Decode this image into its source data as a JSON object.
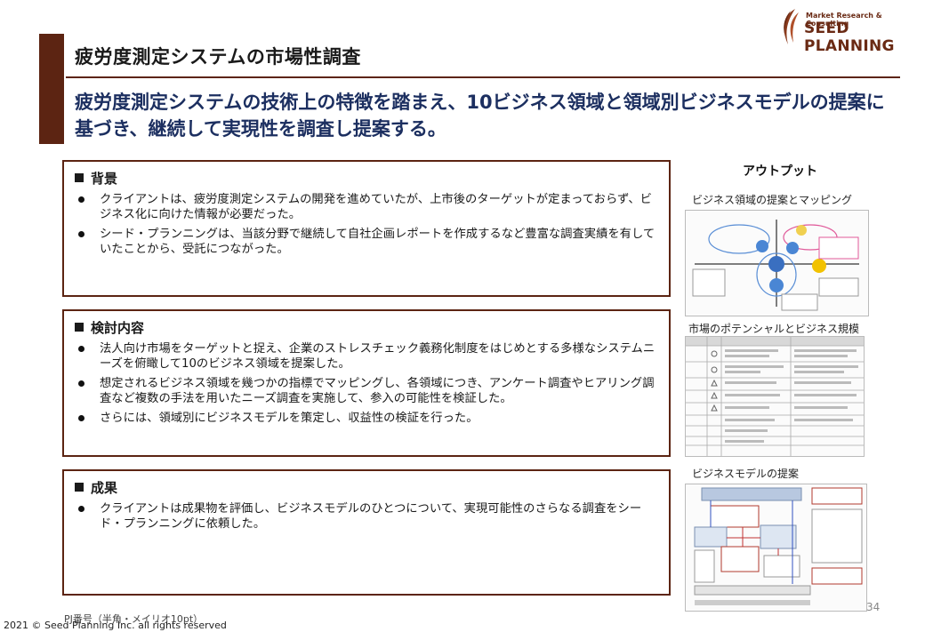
{
  "header": {
    "title": "疲労度測定システムの市場性調査",
    "lead": "疲労度測定システムの技術上の特徴を踏まえ、10ビジネス領域と領域別ビジネスモデルの提案に基づき、継続して実現性を調査し提案する。"
  },
  "logo": {
    "subtitle": "Market Research & Consulting",
    "name": "SEED PLANNING"
  },
  "sections": {
    "background": {
      "title": "背景",
      "items": [
        "クライアントは、疲労度測定システムの開発を進めていたが、上市後のターゲットが定まっておらず、ビジネス化に向けた情報が必要だった。",
        "シード・プランニングは、当該分野で継続して自社企画レポートを作成するなど豊富な調査実績を有していたことから、受託につながった。"
      ]
    },
    "study": {
      "title": "検討内容",
      "items": [
        "法人向け市場をターゲットと捉え、企業のストレスチェック義務化制度をはじめとする多様なシステムニーズを俯瞰して10のビジネス領域を提案した。",
        "想定されるビジネス領域を幾つかの指標でマッピングし、各領域につき、アンケート調査やヒアリング調査など複数の手法を用いたニーズ調査を実施して、参入の可能性を検証した。",
        "さらには、領域別にビジネスモデルを策定し、収益性の検証を行った。"
      ]
    },
    "results": {
      "title": "成果",
      "items": [
        "クライアントは成果物を評価し、ビジネスモデルのひとつについて、実現可能性のさらなる調査をシード・プランニングに依頼した。"
      ]
    }
  },
  "output": {
    "title": "アウトプット",
    "captions": [
      "ビジネス領域の提案とマッピング",
      "市場のポテンシャルとビジネス規模",
      "ビジネスモデルの提案"
    ]
  },
  "footer": {
    "pj": "PJ番号（半角・メイリオ10pt）",
    "copyright": "2021 © Seed Planning Inc. all rights reserved",
    "page": "34"
  }
}
